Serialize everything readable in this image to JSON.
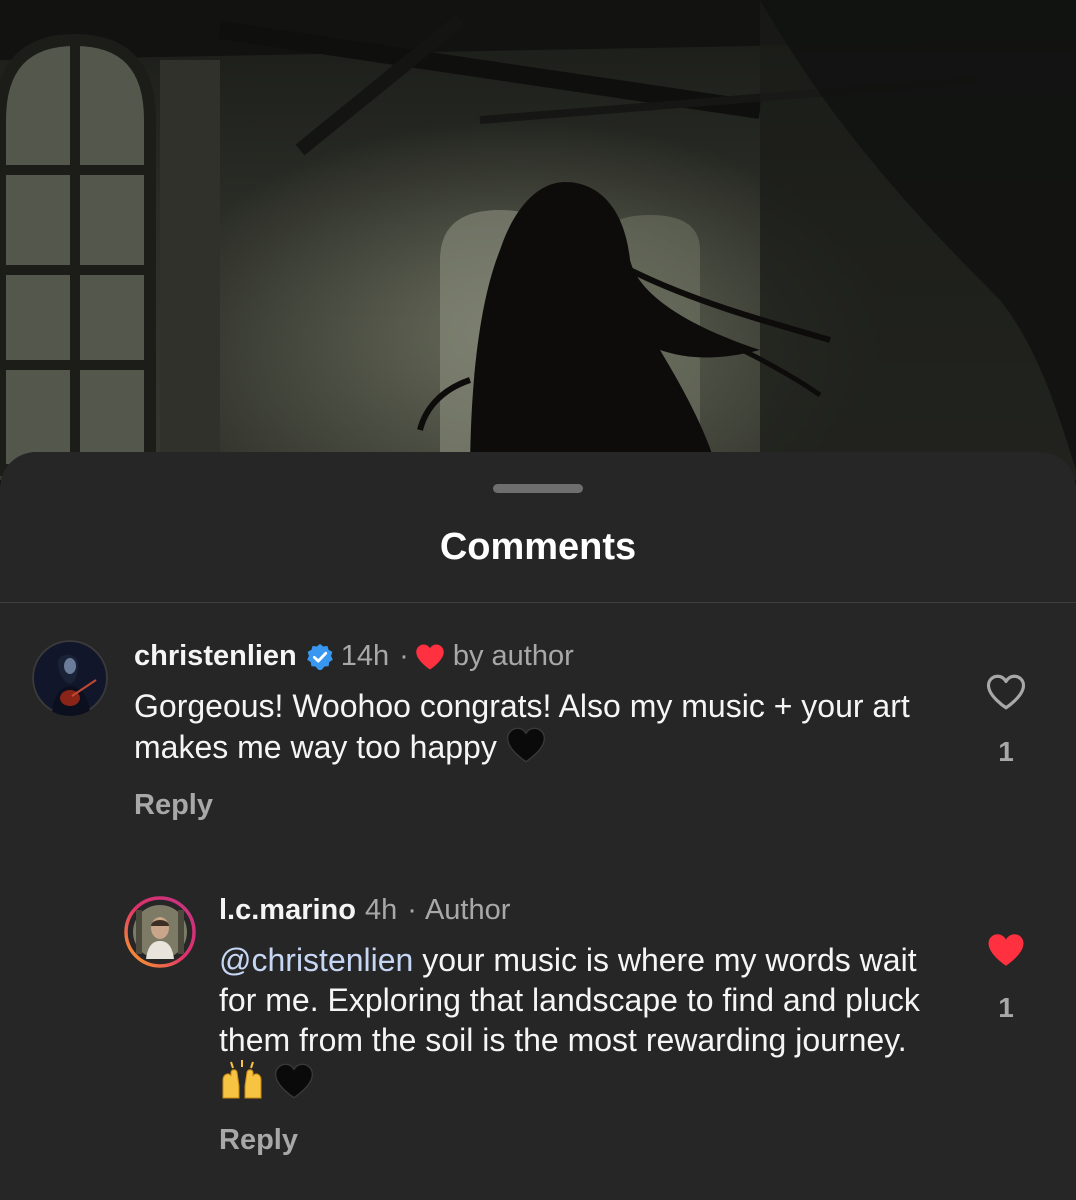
{
  "sheet": {
    "title": "Comments"
  },
  "comments": [
    {
      "username": "christenlien",
      "verified": true,
      "time": "14h",
      "separator": "·",
      "liked_by_author_label": "by author",
      "text": "Gorgeous! Woohoo congrats! Also my music + your art makes me way too happy",
      "emoji": [
        "black-heart"
      ],
      "reply_label": "Reply",
      "like_count": "1",
      "liked": false
    },
    {
      "username": "l.c.marino",
      "time": "4h",
      "separator": "·",
      "badge": "Author",
      "mention": "@christenlien",
      "text": " your music is where my words wait for me. Exploring that landscape to find and pluck them from the soil is the most rewarding journey.",
      "emoji": [
        "raising-hands",
        "black-heart"
      ],
      "reply_label": "Reply",
      "like_count": "1",
      "liked": true
    }
  ],
  "colors": {
    "sheet_bg": "#262626",
    "heart_red": "#ff3040",
    "verified_blue": "#3897f0",
    "muted_text": "#a8a8a8",
    "mention": "#c6d6f5"
  }
}
